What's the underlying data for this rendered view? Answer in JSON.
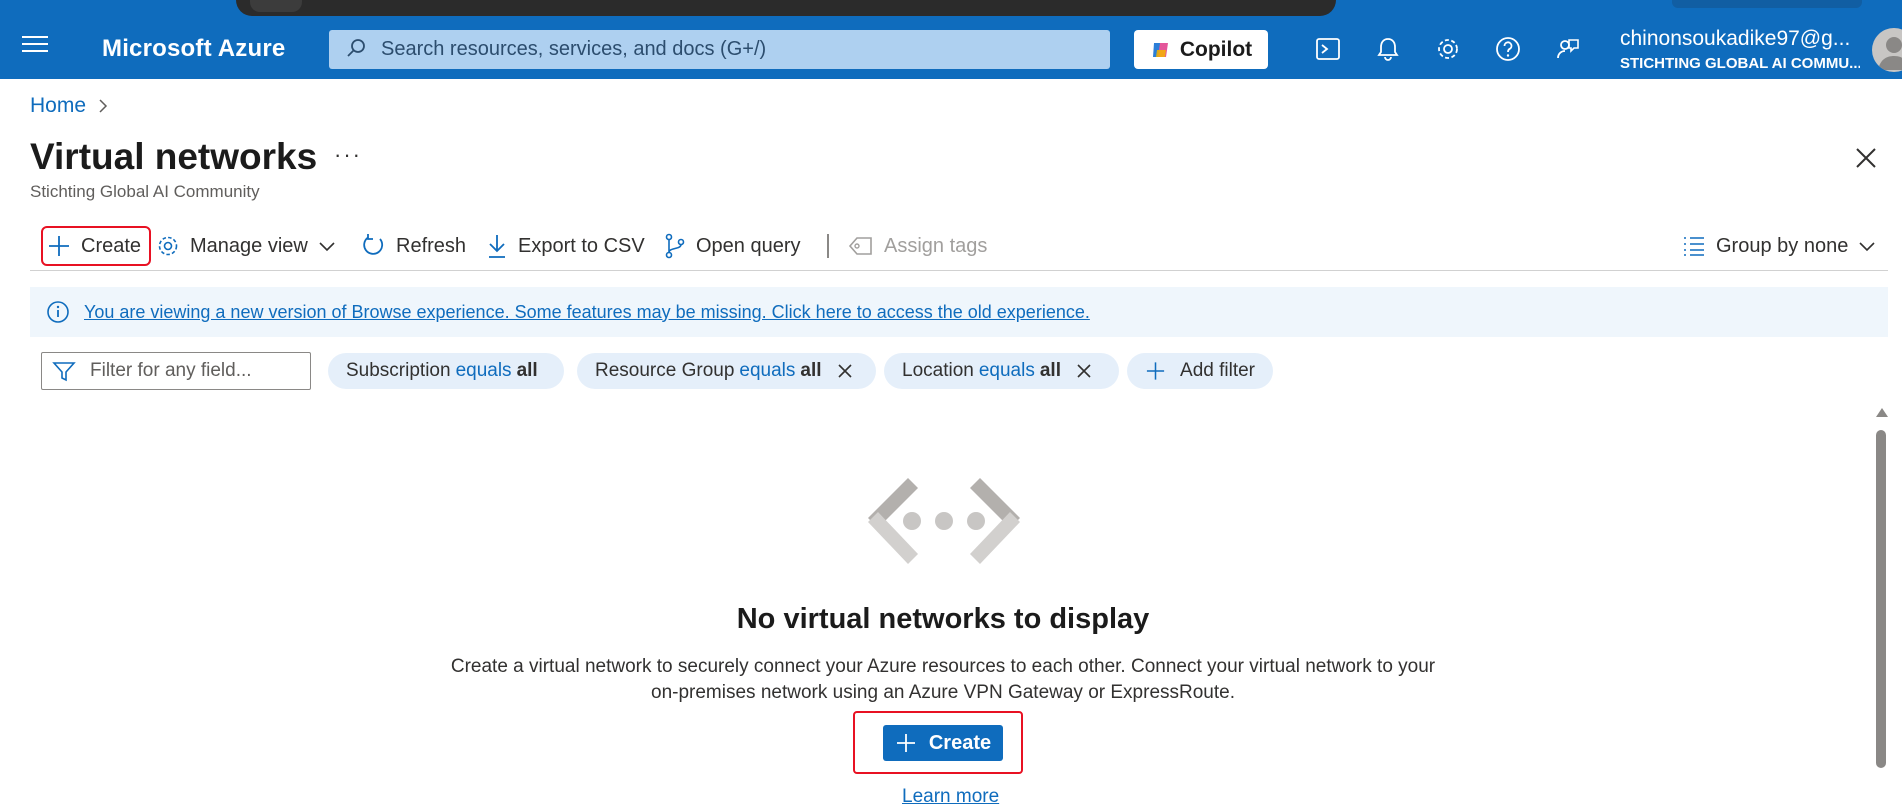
{
  "header": {
    "brand": "Microsoft Azure",
    "search_placeholder": "Search resources, services, and docs (G+/)",
    "copilot_label": "Copilot",
    "account_email": "chinonsoukadike97@g...",
    "account_tenant": "STICHTING GLOBAL AI COMMU...",
    "icons": [
      "cloud-shell-icon",
      "bell-icon",
      "gear-icon",
      "help-icon",
      "feedback-icon"
    ]
  },
  "breadcrumb": {
    "home": "Home"
  },
  "page": {
    "title": "Virtual networks",
    "more": "···",
    "subtitle": "Stichting Global AI Community"
  },
  "toolbar": {
    "create": "Create",
    "manage_view": "Manage view",
    "refresh": "Refresh",
    "export": "Export to CSV",
    "open_query": "Open query",
    "assign_tags": "Assign tags",
    "group_by": "Group by none"
  },
  "banner": {
    "text": "You are viewing a new version of Browse experience. Some features may be missing. Click here to access the old experience."
  },
  "filters": {
    "placeholder": "Filter for any field...",
    "pills": [
      {
        "field": "Subscription",
        "op": "equals",
        "value": "all"
      },
      {
        "field": "Resource Group",
        "op": "equals",
        "value": "all"
      },
      {
        "field": "Location",
        "op": "equals",
        "value": "all"
      }
    ],
    "add_filter": "Add filter"
  },
  "empty_state": {
    "title": "No virtual networks to display",
    "line1": "Create a virtual network to securely connect your Azure resources to each other. Connect your virtual network to your",
    "line2": "on-premises network using an Azure VPN Gateway or ExpressRoute.",
    "create_label": "Create",
    "learn_more": "Learn more"
  },
  "colors": {
    "header_bg": "#0f6cbd",
    "accent": "#0f6cbd",
    "highlight": "#e81123",
    "pill_bg": "#e5effa",
    "banner_bg": "#eff6fc"
  }
}
